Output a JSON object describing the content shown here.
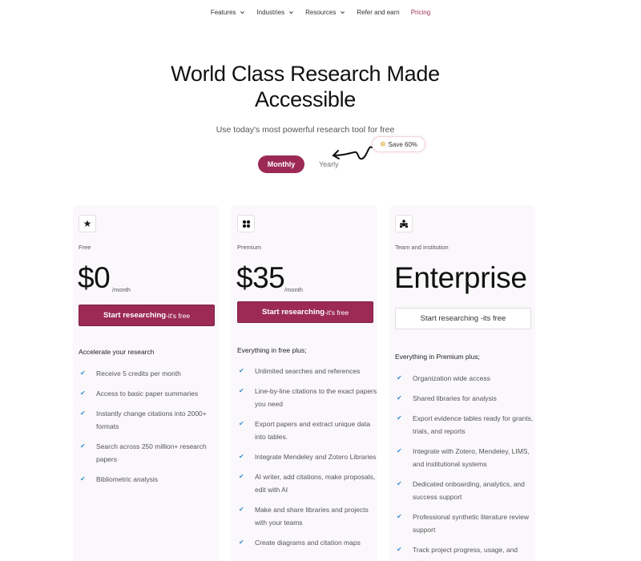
{
  "nav": {
    "items": [
      {
        "label": "Features",
        "has_dropdown": true
      },
      {
        "label": "Industries",
        "has_dropdown": true
      },
      {
        "label": "Resources",
        "has_dropdown": true
      },
      {
        "label": "Refer and earn",
        "has_dropdown": false
      },
      {
        "label": "Pricing",
        "has_dropdown": false
      }
    ]
  },
  "hero": {
    "title_line1": "World Class Research Made",
    "title_line2": "Accessible",
    "subtitle": "Use today's most powerful research tool for free"
  },
  "billing": {
    "monthly": "Monthly",
    "yearly": "Yearly",
    "save_badge": "Save 60%",
    "selected": "Monthly"
  },
  "plans": [
    {
      "icon": "star-icon",
      "name": "Free",
      "price": "$0",
      "per": "/month",
      "cta_main": "Start researching",
      "cta_suffix": "-it's free",
      "features_heading": "Accelerate your research",
      "features": [
        "Receive 5 credits per month",
        "Access to basic paper summaries",
        "Instantly change citations into 2000+ formats",
        "Search across 250 million+ research papers",
        "Bibliometric analysis"
      ]
    },
    {
      "icon": "grid-icon",
      "name": "Premium",
      "price": "$35",
      "per": "/month",
      "cta_main": "Start researching",
      "cta_suffix": "-it's free",
      "features_heading": "Everything in free plus;",
      "features": [
        "Unlimited searches and references",
        "Line-by-line citations to the exact papers you need",
        "Export papers and extract unique data into tables.",
        "Integrate Mendeley and Zotero Libraries",
        "AI writer, add citations, make proposals, edit with AI",
        "Make and share libraries and projects with your teams",
        "Create diagrams and citation maps"
      ]
    },
    {
      "icon": "team-icon",
      "name": "Team and institution",
      "price": "Enterprise",
      "cta_main": "Start researching -its free",
      "features_heading": "Everything in Premium plus;",
      "features": [
        "Organization wide access",
        "Shared libraries for analysis",
        "Export evidence tables ready for grants, trials, and reports",
        "Integrate with Zotero, Mendeley, LIMS, and institutional systems",
        "Dedicated onboarding, analytics, and success support",
        "Professional synthetic literature review support",
        "Track project progress, usage, and outcomes"
      ]
    }
  ],
  "colors": {
    "brand": "#9c2a55",
    "check": "#3b8fd1",
    "card_bg": "#faf8fb"
  }
}
